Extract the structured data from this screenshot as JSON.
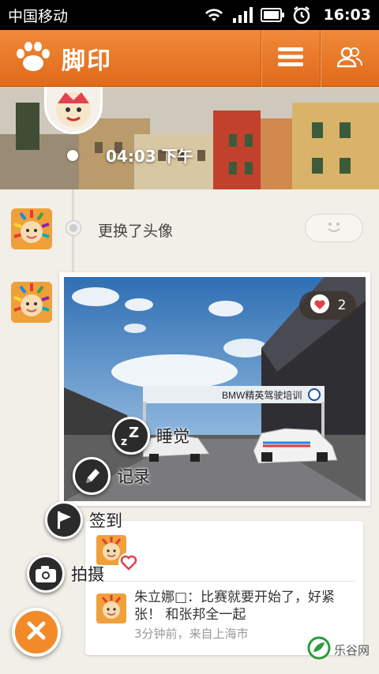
{
  "status_bar": {
    "carrier": "中国移动",
    "time": "16:03",
    "icons": [
      "wifi-icon",
      "signal-icon",
      "battery-icon",
      "alarm-icon"
    ]
  },
  "app_bar": {
    "title": "脚印",
    "icons": [
      "paw-logo-icon",
      "menu-icon",
      "friends-icon"
    ]
  },
  "cover": {
    "time_label": "04:03 下午"
  },
  "timeline": {
    "status_update": "更换了头像"
  },
  "photo_post": {
    "like_count": "2",
    "banner_text": "BMW精英驾驶培训"
  },
  "comments": {
    "items": [
      {
        "text": "朱立娜□：比赛就要开始了，好紧张！ 和张邦全一起",
        "meta": "3分钟前，来自上海市"
      }
    ]
  },
  "radial_menu": {
    "items": [
      {
        "label": "睡觉",
        "icon": "sleep-icon"
      },
      {
        "label": "记录",
        "icon": "pencil-icon"
      },
      {
        "label": "签到",
        "icon": "flag-icon"
      },
      {
        "label": "拍摄",
        "icon": "camera-icon"
      }
    ]
  },
  "watermark": {
    "text": "乐谷网"
  },
  "colors": {
    "brand_orange": "#e8761f",
    "fab_orange": "#f28a2a",
    "heart_red": "#e0404a"
  }
}
